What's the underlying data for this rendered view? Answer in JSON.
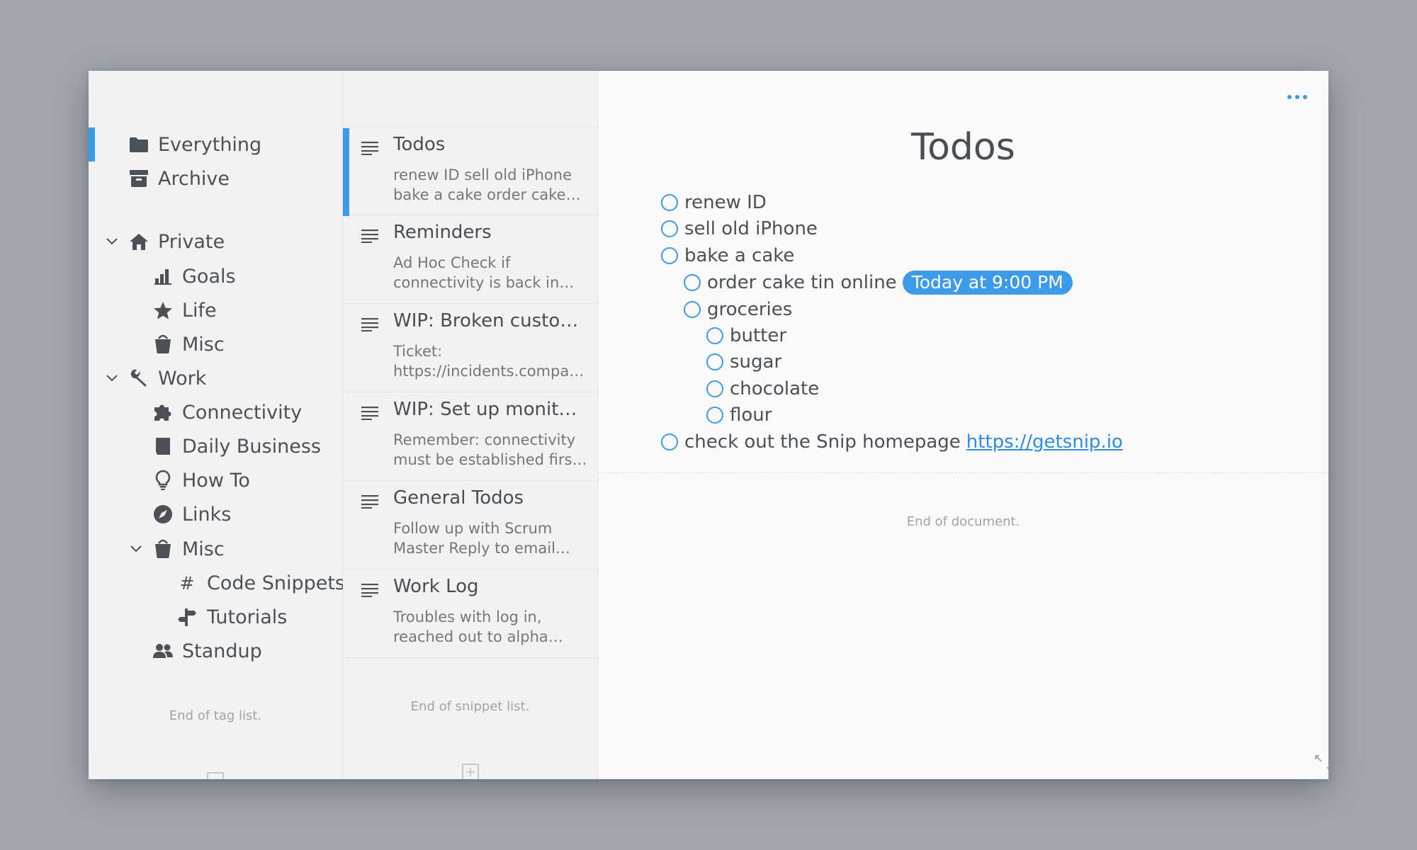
{
  "colors": {
    "accent": "#3b9aea",
    "background": "#a3a6ae",
    "panel": "#f2f2f2",
    "editor": "#f9f9f9",
    "text": "#4b5157"
  },
  "sidebar": {
    "items": [
      {
        "label": "Everything",
        "icon": "folder-icon",
        "active": true
      },
      {
        "label": "Archive",
        "icon": "archive-box-icon"
      },
      {
        "label": "Private",
        "icon": "home-icon",
        "expanded": true
      },
      {
        "label": "Goals",
        "icon": "bar-chart-icon"
      },
      {
        "label": "Life",
        "icon": "star-icon"
      },
      {
        "label": "Misc",
        "icon": "bucket-icon"
      },
      {
        "label": "Work",
        "icon": "wrench-icon",
        "expanded": true
      },
      {
        "label": "Connectivity",
        "icon": "puzzle-icon"
      },
      {
        "label": "Daily Business",
        "icon": "book-icon"
      },
      {
        "label": "How To",
        "icon": "lightbulb-icon"
      },
      {
        "label": "Links",
        "icon": "compass-icon"
      },
      {
        "label": "Misc",
        "icon": "bucket-icon",
        "expanded": true
      },
      {
        "label": "Code Snippets",
        "icon": "hash-icon"
      },
      {
        "label": "Tutorials",
        "icon": "signpost-icon"
      },
      {
        "label": "Standup",
        "icon": "users-icon"
      }
    ],
    "end_note": "End of tag list."
  },
  "snippets": {
    "items": [
      {
        "title": "Todos",
        "preview": "renew ID sell old iPhone bake a cake order cake tin online groceries",
        "selected": true
      },
      {
        "title": "Reminders",
        "preview": "Ad Hoc Check if connectivity is back in the evening"
      },
      {
        "title": "WIP: Broken customer connection",
        "preview": "Ticket: https://incidents.company.com"
      },
      {
        "title": "WIP: Set up monitoring",
        "preview": "Remember: connectivity must be established first before"
      },
      {
        "title": "General Todos",
        "preview": "Follow up with Scrum Master Reply to email from HR"
      },
      {
        "title": "Work Log",
        "preview": "Troubles with log in, reached out to alpha team"
      }
    ],
    "end_note": "End of snippet list."
  },
  "editor": {
    "title": "Todos",
    "todos": [
      {
        "text": "renew ID",
        "level": 0
      },
      {
        "text": "sell old iPhone",
        "level": 0
      },
      {
        "text": "bake a cake",
        "level": 0
      },
      {
        "text": "order cake tin online",
        "level": 1,
        "due": "Today at 9:00 PM"
      },
      {
        "text": "groceries",
        "level": 1
      },
      {
        "text": "butter",
        "level": 2
      },
      {
        "text": "sugar",
        "level": 2
      },
      {
        "text": "chocolate",
        "level": 2
      },
      {
        "text": "flour",
        "level": 2
      },
      {
        "text": "check out the Snip homepage",
        "level": 0,
        "link": "https://getsnip.io"
      }
    ],
    "end_note": "End of document."
  }
}
